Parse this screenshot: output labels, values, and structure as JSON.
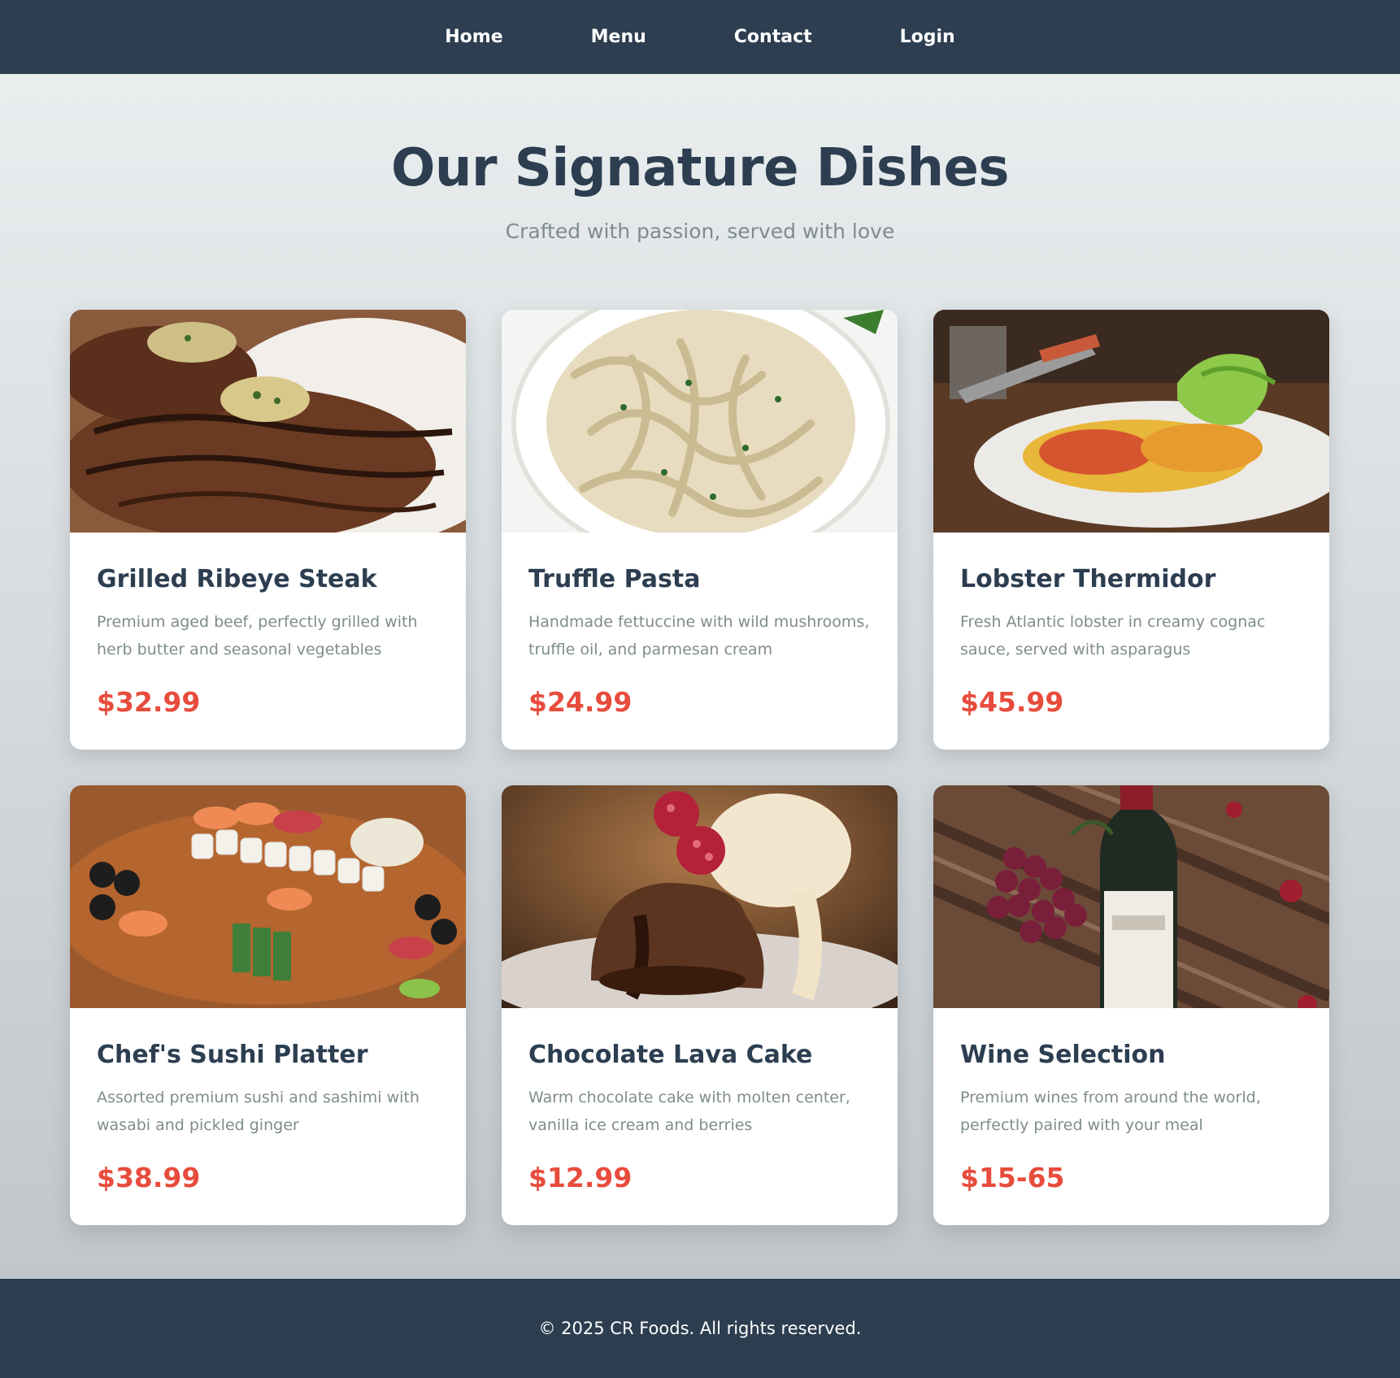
{
  "nav": {
    "items": [
      {
        "label": "Home"
      },
      {
        "label": "Menu"
      },
      {
        "label": "Contact"
      },
      {
        "label": "Login"
      }
    ]
  },
  "hero": {
    "title": "Our Signature Dishes",
    "subtitle": "Crafted with passion, served with love"
  },
  "dishes": [
    {
      "title": "Grilled Ribeye Steak",
      "description": "Premium aged beef, perfectly grilled with herb butter and seasonal vegetables",
      "price": "$32.99",
      "image": "steak-photo"
    },
    {
      "title": "Truffle Pasta",
      "description": "Handmade fettuccine with wild mushrooms, truffle oil, and parmesan cream",
      "price": "$24.99",
      "image": "pasta-photo"
    },
    {
      "title": "Lobster Thermidor",
      "description": "Fresh Atlantic lobster in creamy cognac sauce, served with asparagus",
      "price": "$45.99",
      "image": "lobster-photo"
    },
    {
      "title": "Chef's Sushi Platter",
      "description": "Assorted premium sushi and sashimi with wasabi and pickled ginger",
      "price": "$38.99",
      "image": "sushi-photo"
    },
    {
      "title": "Chocolate Lava Cake",
      "description": "Warm chocolate cake with molten center, vanilla ice cream and berries",
      "price": "$12.99",
      "image": "lava-cake-photo"
    },
    {
      "title": "Wine Selection",
      "description": "Premium wines from around the world, perfectly paired with your meal",
      "price": "$15-65",
      "image": "wine-photo"
    }
  ],
  "footer": {
    "text": "© 2025 CR Foods. All rights reserved."
  },
  "colors": {
    "nav_bg": "#2c3e50",
    "heading": "#2c3e50",
    "muted": "#7f8c8d",
    "price": "#e74c3c"
  }
}
